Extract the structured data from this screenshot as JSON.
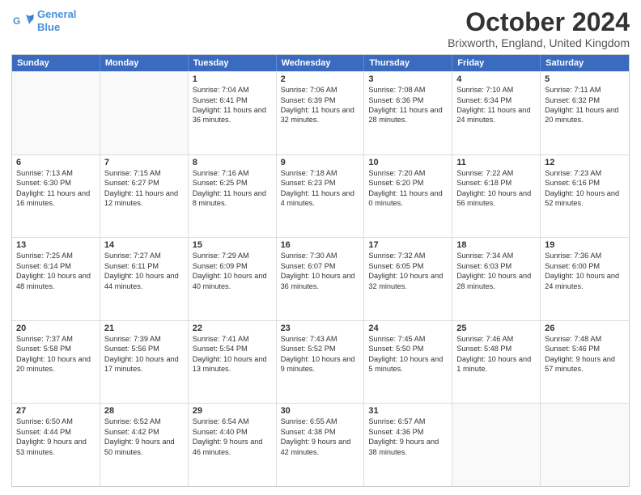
{
  "header": {
    "logo_line1": "General",
    "logo_line2": "Blue",
    "month": "October 2024",
    "location": "Brixworth, England, United Kingdom"
  },
  "weekdays": [
    "Sunday",
    "Monday",
    "Tuesday",
    "Wednesday",
    "Thursday",
    "Friday",
    "Saturday"
  ],
  "weeks": [
    [
      {
        "day": "",
        "sunrise": "",
        "sunset": "",
        "daylight": ""
      },
      {
        "day": "",
        "sunrise": "",
        "sunset": "",
        "daylight": ""
      },
      {
        "day": "1",
        "sunrise": "Sunrise: 7:04 AM",
        "sunset": "Sunset: 6:41 PM",
        "daylight": "Daylight: 11 hours and 36 minutes."
      },
      {
        "day": "2",
        "sunrise": "Sunrise: 7:06 AM",
        "sunset": "Sunset: 6:39 PM",
        "daylight": "Daylight: 11 hours and 32 minutes."
      },
      {
        "day": "3",
        "sunrise": "Sunrise: 7:08 AM",
        "sunset": "Sunset: 6:36 PM",
        "daylight": "Daylight: 11 hours and 28 minutes."
      },
      {
        "day": "4",
        "sunrise": "Sunrise: 7:10 AM",
        "sunset": "Sunset: 6:34 PM",
        "daylight": "Daylight: 11 hours and 24 minutes."
      },
      {
        "day": "5",
        "sunrise": "Sunrise: 7:11 AM",
        "sunset": "Sunset: 6:32 PM",
        "daylight": "Daylight: 11 hours and 20 minutes."
      }
    ],
    [
      {
        "day": "6",
        "sunrise": "Sunrise: 7:13 AM",
        "sunset": "Sunset: 6:30 PM",
        "daylight": "Daylight: 11 hours and 16 minutes."
      },
      {
        "day": "7",
        "sunrise": "Sunrise: 7:15 AM",
        "sunset": "Sunset: 6:27 PM",
        "daylight": "Daylight: 11 hours and 12 minutes."
      },
      {
        "day": "8",
        "sunrise": "Sunrise: 7:16 AM",
        "sunset": "Sunset: 6:25 PM",
        "daylight": "Daylight: 11 hours and 8 minutes."
      },
      {
        "day": "9",
        "sunrise": "Sunrise: 7:18 AM",
        "sunset": "Sunset: 6:23 PM",
        "daylight": "Daylight: 11 hours and 4 minutes."
      },
      {
        "day": "10",
        "sunrise": "Sunrise: 7:20 AM",
        "sunset": "Sunset: 6:20 PM",
        "daylight": "Daylight: 11 hours and 0 minutes."
      },
      {
        "day": "11",
        "sunrise": "Sunrise: 7:22 AM",
        "sunset": "Sunset: 6:18 PM",
        "daylight": "Daylight: 10 hours and 56 minutes."
      },
      {
        "day": "12",
        "sunrise": "Sunrise: 7:23 AM",
        "sunset": "Sunset: 6:16 PM",
        "daylight": "Daylight: 10 hours and 52 minutes."
      }
    ],
    [
      {
        "day": "13",
        "sunrise": "Sunrise: 7:25 AM",
        "sunset": "Sunset: 6:14 PM",
        "daylight": "Daylight: 10 hours and 48 minutes."
      },
      {
        "day": "14",
        "sunrise": "Sunrise: 7:27 AM",
        "sunset": "Sunset: 6:11 PM",
        "daylight": "Daylight: 10 hours and 44 minutes."
      },
      {
        "day": "15",
        "sunrise": "Sunrise: 7:29 AM",
        "sunset": "Sunset: 6:09 PM",
        "daylight": "Daylight: 10 hours and 40 minutes."
      },
      {
        "day": "16",
        "sunrise": "Sunrise: 7:30 AM",
        "sunset": "Sunset: 6:07 PM",
        "daylight": "Daylight: 10 hours and 36 minutes."
      },
      {
        "day": "17",
        "sunrise": "Sunrise: 7:32 AM",
        "sunset": "Sunset: 6:05 PM",
        "daylight": "Daylight: 10 hours and 32 minutes."
      },
      {
        "day": "18",
        "sunrise": "Sunrise: 7:34 AM",
        "sunset": "Sunset: 6:03 PM",
        "daylight": "Daylight: 10 hours and 28 minutes."
      },
      {
        "day": "19",
        "sunrise": "Sunrise: 7:36 AM",
        "sunset": "Sunset: 6:00 PM",
        "daylight": "Daylight: 10 hours and 24 minutes."
      }
    ],
    [
      {
        "day": "20",
        "sunrise": "Sunrise: 7:37 AM",
        "sunset": "Sunset: 5:58 PM",
        "daylight": "Daylight: 10 hours and 20 minutes."
      },
      {
        "day": "21",
        "sunrise": "Sunrise: 7:39 AM",
        "sunset": "Sunset: 5:56 PM",
        "daylight": "Daylight: 10 hours and 17 minutes."
      },
      {
        "day": "22",
        "sunrise": "Sunrise: 7:41 AM",
        "sunset": "Sunset: 5:54 PM",
        "daylight": "Daylight: 10 hours and 13 minutes."
      },
      {
        "day": "23",
        "sunrise": "Sunrise: 7:43 AM",
        "sunset": "Sunset: 5:52 PM",
        "daylight": "Daylight: 10 hours and 9 minutes."
      },
      {
        "day": "24",
        "sunrise": "Sunrise: 7:45 AM",
        "sunset": "Sunset: 5:50 PM",
        "daylight": "Daylight: 10 hours and 5 minutes."
      },
      {
        "day": "25",
        "sunrise": "Sunrise: 7:46 AM",
        "sunset": "Sunset: 5:48 PM",
        "daylight": "Daylight: 10 hours and 1 minute."
      },
      {
        "day": "26",
        "sunrise": "Sunrise: 7:48 AM",
        "sunset": "Sunset: 5:46 PM",
        "daylight": "Daylight: 9 hours and 57 minutes."
      }
    ],
    [
      {
        "day": "27",
        "sunrise": "Sunrise: 6:50 AM",
        "sunset": "Sunset: 4:44 PM",
        "daylight": "Daylight: 9 hours and 53 minutes."
      },
      {
        "day": "28",
        "sunrise": "Sunrise: 6:52 AM",
        "sunset": "Sunset: 4:42 PM",
        "daylight": "Daylight: 9 hours and 50 minutes."
      },
      {
        "day": "29",
        "sunrise": "Sunrise: 6:54 AM",
        "sunset": "Sunset: 4:40 PM",
        "daylight": "Daylight: 9 hours and 46 minutes."
      },
      {
        "day": "30",
        "sunrise": "Sunrise: 6:55 AM",
        "sunset": "Sunset: 4:38 PM",
        "daylight": "Daylight: 9 hours and 42 minutes."
      },
      {
        "day": "31",
        "sunrise": "Sunrise: 6:57 AM",
        "sunset": "Sunset: 4:36 PM",
        "daylight": "Daylight: 9 hours and 38 minutes."
      },
      {
        "day": "",
        "sunrise": "",
        "sunset": "",
        "daylight": ""
      },
      {
        "day": "",
        "sunrise": "",
        "sunset": "",
        "daylight": ""
      }
    ]
  ]
}
